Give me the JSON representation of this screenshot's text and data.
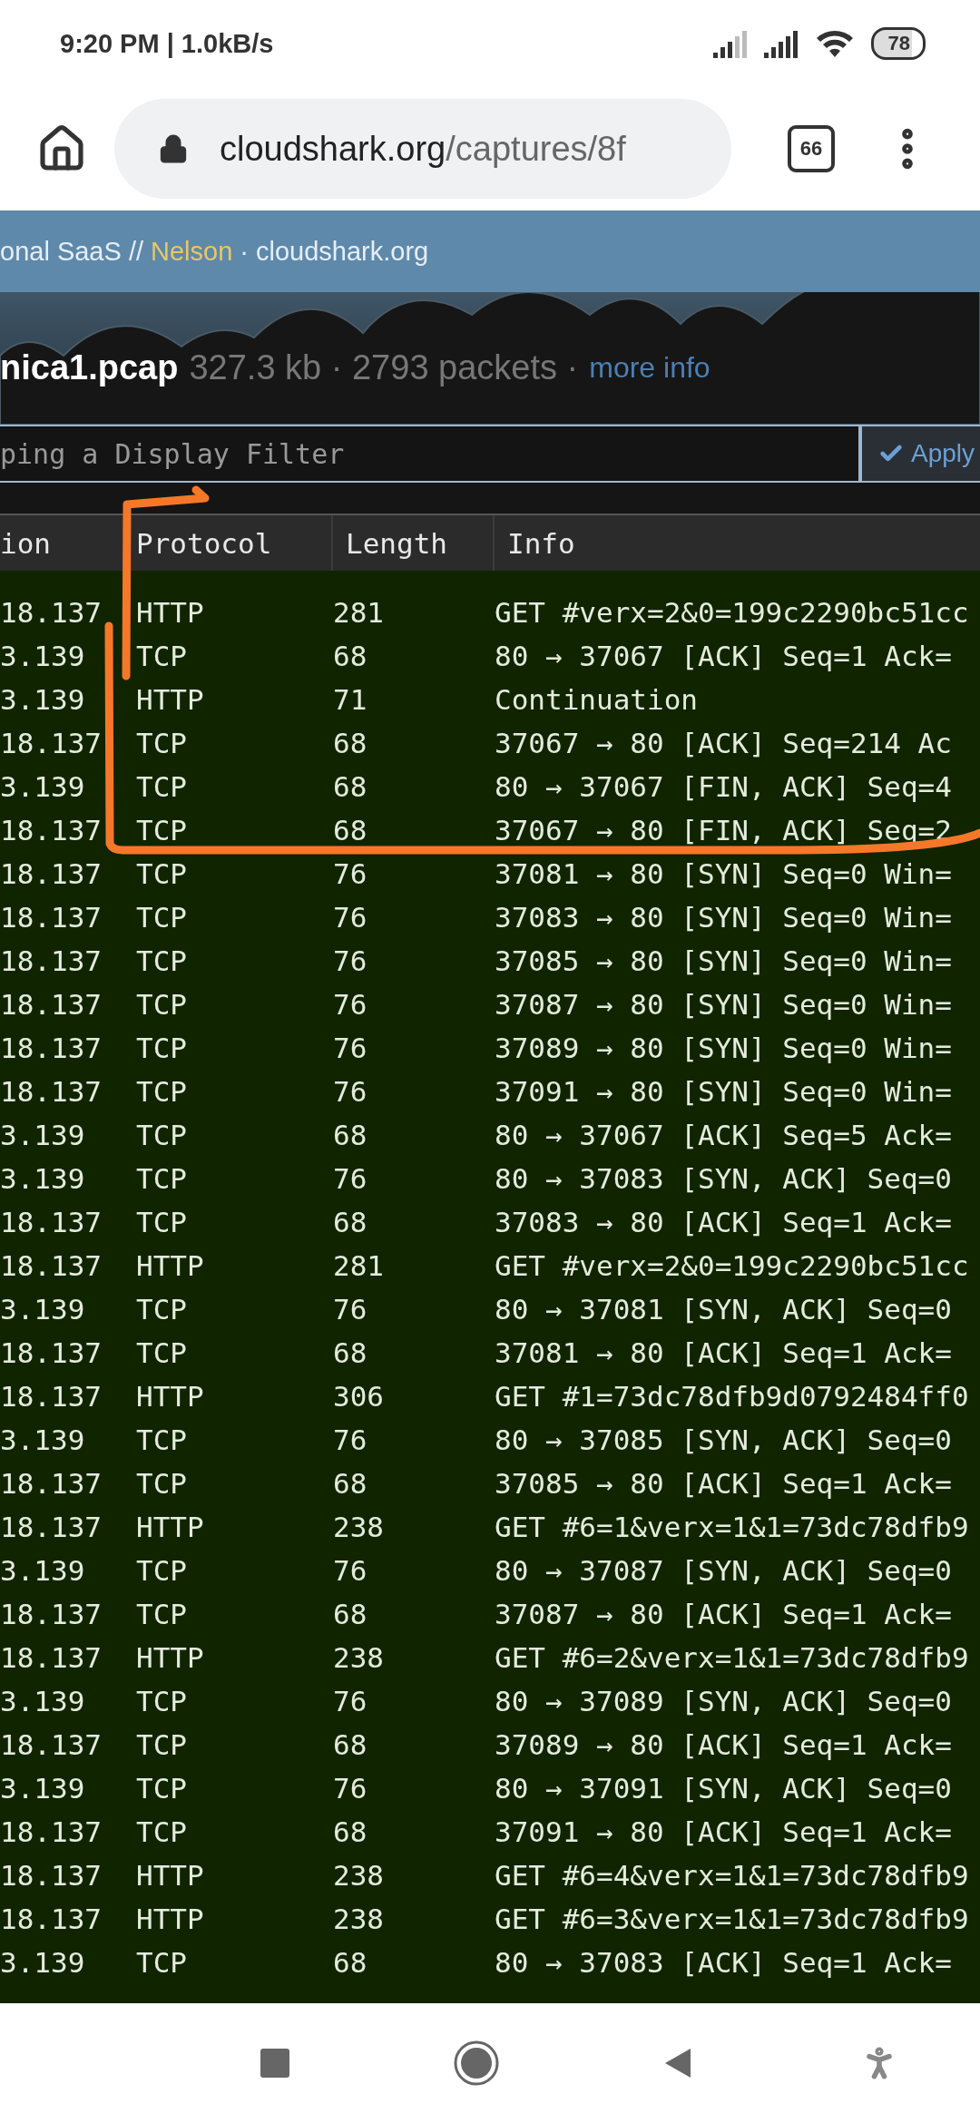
{
  "status_bar": {
    "time": "9:20 PM | 1.0kB/s",
    "battery": "78"
  },
  "browser": {
    "url_host": "cloudshark.org",
    "url_path": "/captures/8f",
    "tab_count": "66"
  },
  "site_bar": {
    "prefix": "onal SaaS //",
    "user": "Nelson",
    "suffix": "· cloudshark.org"
  },
  "capture": {
    "filename": "nica1.pcap",
    "details": "327.3 kb · 2793 packets ·",
    "more_link": "more info"
  },
  "filter": {
    "placeholder": "ping a Display Filter",
    "apply_label": "Apply"
  },
  "table": {
    "columns": [
      "ion",
      "Protocol",
      "Length",
      "Info"
    ],
    "rows": [
      [
        "18.137",
        "HTTP",
        "281",
        "GET #verx=2&0=199c2290bc51cc"
      ],
      [
        "3.139",
        "TCP",
        "68",
        "80 → 37067 [ACK] Seq=1 Ack="
      ],
      [
        "3.139",
        "HTTP",
        "71",
        "Continuation"
      ],
      [
        "18.137",
        "TCP",
        "68",
        "37067 → 80 [ACK] Seq=214 Ac"
      ],
      [
        "3.139",
        "TCP",
        "68",
        "80 → 37067 [FIN, ACK] Seq=4"
      ],
      [
        "18.137",
        "TCP",
        "68",
        "37067 → 80 [FIN, ACK] Seq=2"
      ],
      [
        "18.137",
        "TCP",
        "76",
        "37081 → 80 [SYN] Seq=0 Win="
      ],
      [
        "18.137",
        "TCP",
        "76",
        "37083 → 80 [SYN] Seq=0 Win="
      ],
      [
        "18.137",
        "TCP",
        "76",
        "37085 → 80 [SYN] Seq=0 Win="
      ],
      [
        "18.137",
        "TCP",
        "76",
        "37087 → 80 [SYN] Seq=0 Win="
      ],
      [
        "18.137",
        "TCP",
        "76",
        "37089 → 80 [SYN] Seq=0 Win="
      ],
      [
        "18.137",
        "TCP",
        "76",
        "37091 → 80 [SYN] Seq=0 Win="
      ],
      [
        "3.139",
        "TCP",
        "68",
        "80 → 37067 [ACK] Seq=5 Ack="
      ],
      [
        "3.139",
        "TCP",
        "76",
        "80 → 37083 [SYN, ACK] Seq=0"
      ],
      [
        "18.137",
        "TCP",
        "68",
        "37083 → 80 [ACK] Seq=1 Ack="
      ],
      [
        "18.137",
        "HTTP",
        "281",
        "GET #verx=2&0=199c2290bc51cc"
      ],
      [
        "3.139",
        "TCP",
        "76",
        "80 → 37081 [SYN, ACK] Seq=0"
      ],
      [
        "18.137",
        "TCP",
        "68",
        "37081 → 80 [ACK] Seq=1 Ack="
      ],
      [
        "18.137",
        "HTTP",
        "306",
        "GET #1=73dc78dfb9d0792484ff0"
      ],
      [
        "3.139",
        "TCP",
        "76",
        "80 → 37085 [SYN, ACK] Seq=0"
      ],
      [
        "18.137",
        "TCP",
        "68",
        "37085 → 80 [ACK] Seq=1 Ack="
      ],
      [
        "18.137",
        "HTTP",
        "238",
        "GET #6=1&verx=1&1=73dc78dfb9"
      ],
      [
        "3.139",
        "TCP",
        "76",
        "80 → 37087 [SYN, ACK] Seq=0"
      ],
      [
        "18.137",
        "TCP",
        "68",
        "37087 → 80 [ACK] Seq=1 Ack="
      ],
      [
        "18.137",
        "HTTP",
        "238",
        "GET #6=2&verx=1&1=73dc78dfb9"
      ],
      [
        "3.139",
        "TCP",
        "76",
        "80 → 37089 [SYN, ACK] Seq=0"
      ],
      [
        "18.137",
        "TCP",
        "68",
        "37089 → 80 [ACK] Seq=1 Ack="
      ],
      [
        "3.139",
        "TCP",
        "76",
        "80 → 37091 [SYN, ACK] Seq=0"
      ],
      [
        "18.137",
        "TCP",
        "68",
        "37091 → 80 [ACK] Seq=1 Ack="
      ],
      [
        "18.137",
        "HTTP",
        "238",
        "GET #6=4&verx=1&1=73dc78dfb9"
      ],
      [
        "18.137",
        "HTTP",
        "238",
        "GET #6=3&verx=1&1=73dc78dfb9"
      ],
      [
        "3.139",
        "TCP",
        "68",
        "80 → 37083 [ACK] Seq=1 Ack="
      ]
    ]
  }
}
